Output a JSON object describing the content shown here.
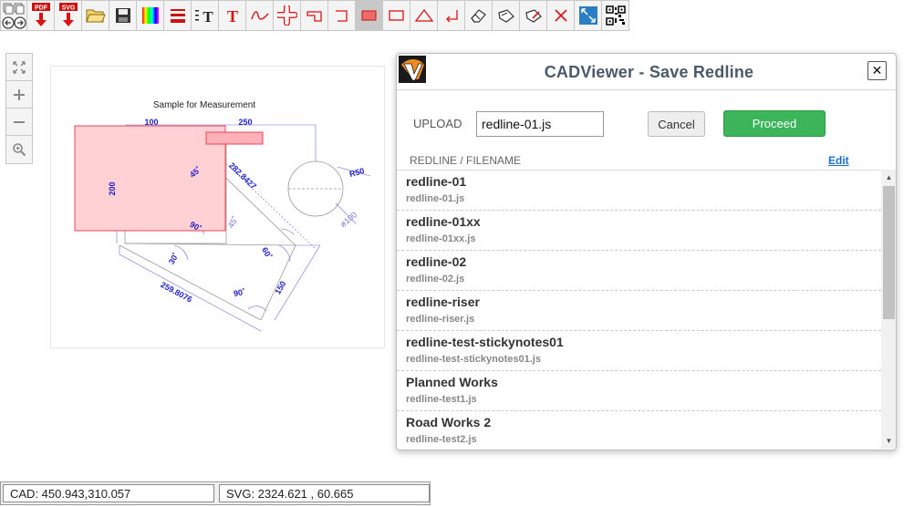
{
  "toolbar": {
    "items": [
      {
        "name": "back-forward",
        "label": ""
      },
      {
        "name": "pdf-download",
        "label": "PDF"
      },
      {
        "name": "svg-download",
        "label": "SVG"
      },
      {
        "name": "open-folder",
        "label": ""
      },
      {
        "name": "save",
        "label": ""
      },
      {
        "name": "color-palette",
        "label": ""
      },
      {
        "name": "line-weight",
        "label": ""
      },
      {
        "name": "text-size",
        "label": "T"
      },
      {
        "name": "text",
        "label": "T"
      },
      {
        "name": "freehand",
        "label": ""
      },
      {
        "name": "cloud",
        "label": ""
      },
      {
        "name": "arrow-callout",
        "label": ""
      },
      {
        "name": "polyline",
        "label": ""
      },
      {
        "name": "filled-rectangle",
        "label": ""
      },
      {
        "name": "rectangle",
        "label": ""
      },
      {
        "name": "triangle",
        "label": ""
      },
      {
        "name": "return-arrow",
        "label": ""
      },
      {
        "name": "eraser",
        "label": ""
      },
      {
        "name": "sticky-note",
        "label": ""
      },
      {
        "name": "sticky-note-alt",
        "label": ""
      },
      {
        "name": "delete",
        "label": ""
      },
      {
        "name": "fit-screen",
        "label": ""
      },
      {
        "name": "qr-code",
        "label": ""
      }
    ],
    "colors": {
      "accent_red": "#dd1111",
      "active_bg": "#c8c8c8"
    }
  },
  "zoom_panel": {
    "icons": [
      "expand-icon",
      "zoom-in-icon",
      "zoom-out-icon",
      "zoom-magnifier-icon"
    ]
  },
  "drawing": {
    "title": "Sample for Measurement",
    "dims": {
      "d100": "100",
      "d250": "250",
      "d200": "200",
      "a45": "45˚",
      "d282": "282.8427",
      "r50": "R50",
      "a45b": "45˚",
      "a90": "90˚",
      "d100c": "ø100",
      "a30": "30˚",
      "a60": "60˚",
      "a90b": "90˚",
      "d259": "259.8076",
      "d150": "150"
    },
    "colors": {
      "dimension": "#2222cc",
      "redline_fill": "#ffd0d4",
      "redline_stroke": "#ee4455"
    }
  },
  "dialog": {
    "title": "CADViewer - Save Redline",
    "upload_label": "UPLOAD",
    "upload_value": "redline-01.js",
    "cancel_label": "Cancel",
    "proceed_label": "Proceed",
    "list_header": "REDLINE / FILENAME",
    "edit_label": "Edit",
    "files": [
      {
        "name": "redline-01",
        "file": "redline-01.js"
      },
      {
        "name": "redline-01xx",
        "file": "redline-01xx.js"
      },
      {
        "name": "redline-02",
        "file": "redline-02.js"
      },
      {
        "name": "redline-riser",
        "file": "redline-riser.js"
      },
      {
        "name": "redline-test-stickynotes01",
        "file": "redline-test-stickynotes01.js"
      },
      {
        "name": "Planned Works",
        "file": "redline-test1.js"
      },
      {
        "name": "Road Works 2",
        "file": "redline-test2.js"
      }
    ],
    "colors": {
      "proceed": "#3cb55a",
      "title": "#4a5a6c",
      "link": "#1a6fcf"
    }
  },
  "status": {
    "cad": "CAD: 450.943,310.057",
    "svg": "SVG: 2324.621 , 60.665"
  }
}
